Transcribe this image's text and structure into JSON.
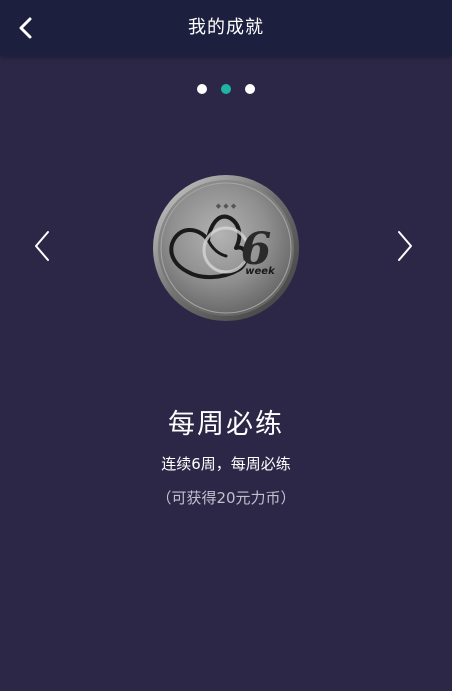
{
  "header": {
    "title": "我的成就",
    "back_icon": "chevron-left-icon"
  },
  "carousel": {
    "page_count": 3,
    "active_index": 1,
    "active_color": "#1fb5a5",
    "inactive_color": "#ffffff",
    "prev_icon": "chevron-left-icon",
    "next_icon": "chevron-right-icon"
  },
  "achievement": {
    "badge_icon": "weekly-medal-icon",
    "badge_number": "6",
    "badge_caption": "week",
    "title": "每周必练",
    "description": "连续6周，每周必练",
    "reward": "（可获得20元力币）"
  },
  "colors": {
    "background": "#2c2747",
    "header_background": "#1d1f3f"
  }
}
